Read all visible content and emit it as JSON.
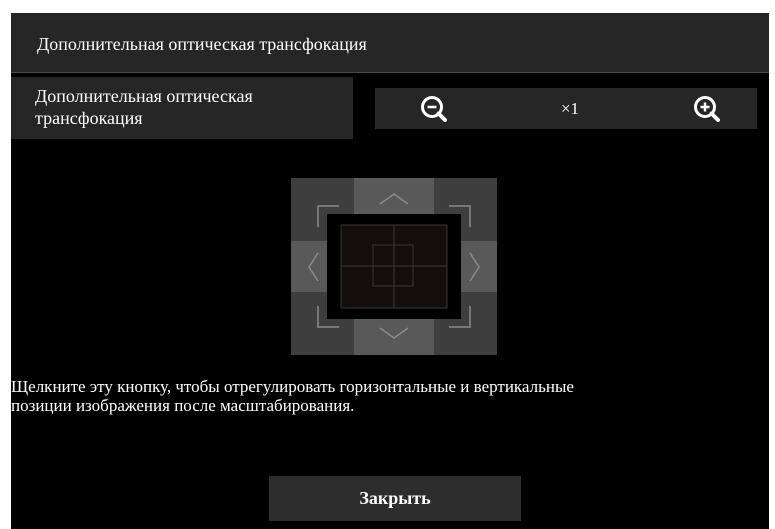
{
  "dialog": {
    "title": "Дополнительная оптическая трансфокация"
  },
  "zoom": {
    "label": "Дополнительная оптическая трансфокация",
    "value": "×1",
    "zoom_out_icon": "zoom-out-magnifier",
    "zoom_in_icon": "zoom-in-magnifier"
  },
  "pan_pad": {
    "icons": [
      "corner-up-left",
      "arrow-up",
      "corner-up-right",
      "arrow-left",
      "arrow-right",
      "corner-down-left",
      "arrow-down",
      "corner-down-right"
    ],
    "colors": {
      "corner": "#3e3e3e",
      "edge": "#595959",
      "center_bg": "#000000",
      "frame_fill": "#140d0d",
      "glyph": "#8a8a8a"
    }
  },
  "instructions": "Щелкните эту кнопку, чтобы отрегулировать горизонтальные и вертикальные\nпозиции изображения после масштабирования.",
  "buttons": {
    "close_label": "Закрыть"
  },
  "colors": {
    "background": "#000000",
    "panel": "#262626",
    "text": "#ffffff"
  }
}
